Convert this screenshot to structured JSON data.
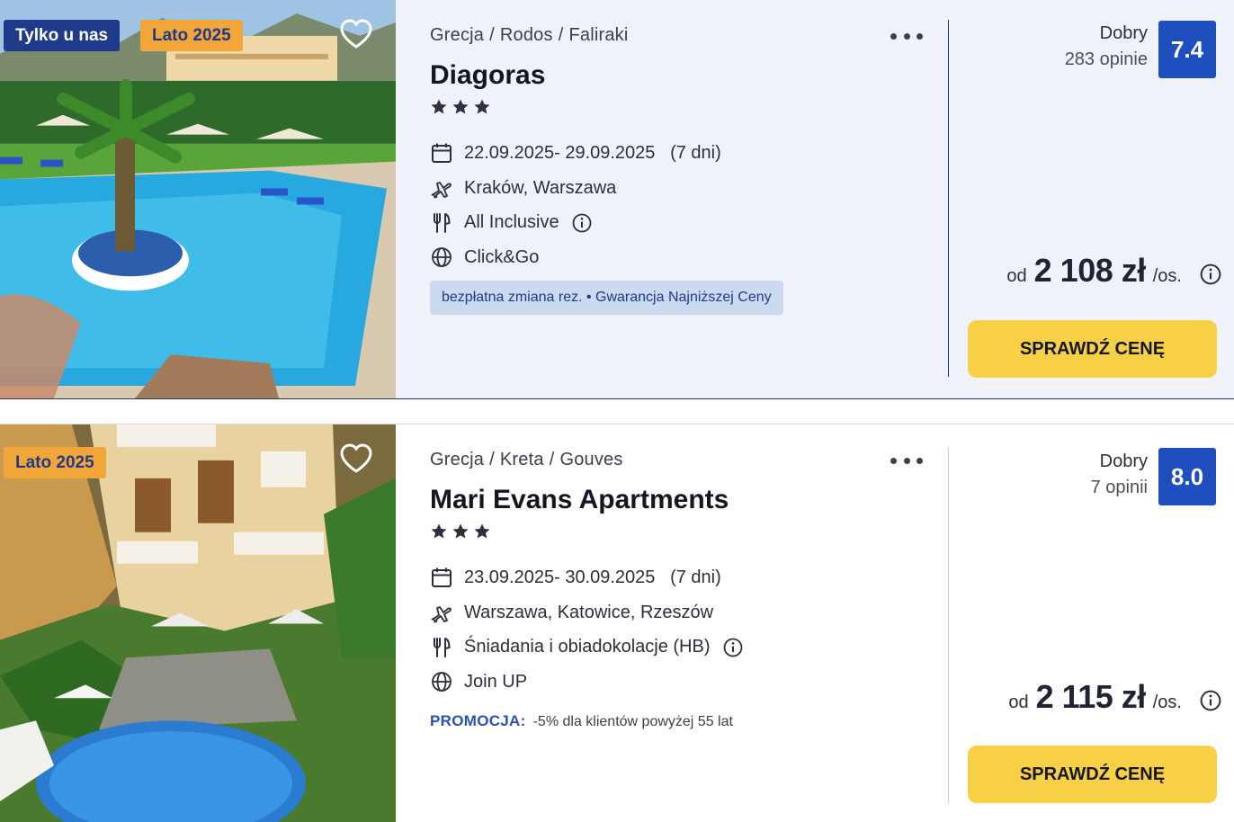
{
  "listings": [
    {
      "badges": {
        "exclusive": "Tylko u nas",
        "season": "Lato 2025"
      },
      "location": {
        "country": "Grecja",
        "region": "Rodos",
        "city": "Faliraki",
        "separator": "/"
      },
      "name": "Diagoras",
      "stars": 3,
      "dates": "22.09.2025- 29.09.2025",
      "duration": "(7 dni)",
      "departure": "Kraków, Warszawa",
      "board": "All Inclusive",
      "operator": "Click&Go",
      "tags": "bezpłatna zmiana rez. • Gwarancja Najniższej Ceny",
      "rating": {
        "word": "Dobry",
        "count": "283 opinie",
        "score": "7.4"
      },
      "price": {
        "from": "od",
        "amount": "2 108 zł",
        "unit": "/os."
      },
      "cta": "SPRAWDŹ CENĘ"
    },
    {
      "badges": {
        "season": "Lato 2025"
      },
      "location": {
        "country": "Grecja",
        "region": "Kreta",
        "city": "Gouves",
        "separator": "/"
      },
      "name": "Mari Evans Apartments",
      "stars": 3,
      "dates": "23.09.2025- 30.09.2025",
      "duration": "(7 dni)",
      "departure": "Warszawa, Katowice, Rzeszów",
      "board": "Śniadania i obiadokolacje (HB)",
      "operator": "Join UP",
      "promo": {
        "label": "PROMOCJA:",
        "text": "-5% dla klientów powyżej 55 lat"
      },
      "rating": {
        "word": "Dobry",
        "count": "7 opinii",
        "score": "8.0"
      },
      "price": {
        "from": "od",
        "amount": "2 115 zł",
        "unit": "/os."
      },
      "cta": "SPRAWDŹ CENĘ"
    }
  ],
  "icons": {
    "favorite": "heart-outline-icon",
    "more": "more-dots-icon",
    "calendar": "calendar-icon",
    "flight": "plane-icon",
    "board": "cutlery-icon",
    "operator": "globe-icon",
    "info": "info-circle-icon",
    "star": "star-icon"
  },
  "colors": {
    "brand_blue": "#1f3a8a",
    "score_blue": "#1f4fbf",
    "cta_yellow": "#f7d046",
    "season_orange": "#f2a63a",
    "card_bg": "#eff3f9",
    "tag_bg": "#ccdaf0"
  }
}
